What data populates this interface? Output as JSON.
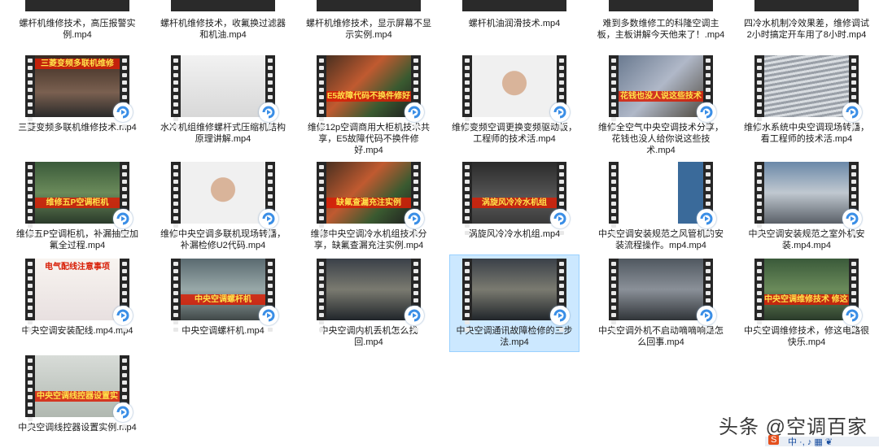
{
  "top_row": [
    {
      "label": "螺杆机维修技术，高压报警实例.mp4"
    },
    {
      "label": "螺杆机维修技术，收氟换过滤器和机油.mp4"
    },
    {
      "label": "螺杆机维修技术，显示屏幕不显示实例.mp4"
    },
    {
      "label": "螺杆机油润滑技术.mp4"
    },
    {
      "label": "难到多数维修工的科隆空调主板，主板讲解今天他来了！.mp4"
    },
    {
      "label": "四冷水机制冷效果差，维修调试2小时搞定开车用了8小时.mp4"
    }
  ],
  "files": [
    {
      "label": "三菱变频多联机维修技术.mp4",
      "banner": "三菱变频多联机维修",
      "theme": "panel"
    },
    {
      "label": "水冷机组维修螺杆式压缩机结构原理讲解.mp4",
      "banner": "",
      "theme": "white"
    },
    {
      "label": "维修12p空调商用大柜机技术共享，E5故障代码不换件修好.mp4",
      "banner": "E5故障代码不换件修好",
      "theme": "board"
    },
    {
      "label": "维修变频空调更换变频驱动板，工程师的技术活.mp4",
      "banner": "",
      "theme": "face"
    },
    {
      "label": "维修全空气中央空调技术分享，花钱也没人给你说这些技术.mp4",
      "banner": "花钱也没人说这些技术",
      "theme": "wires"
    },
    {
      "label": "维修水系统中央空调现场转播，看工程师的技术活.mp4",
      "banner": "",
      "theme": "grille"
    },
    {
      "label": "维修五P空调柜机，补漏抽空加氟全过程.mp4",
      "banner": "维修五P空调柜机",
      "theme": "green"
    },
    {
      "label": "维修中央空调多联机现场转播，补漏检修U2代码.mp4",
      "banner": "",
      "theme": "face"
    },
    {
      "label": "维修中央空调冷水机组技术分享，缺氟查漏充注实例.mp4",
      "banner": "缺氟查漏充注实例",
      "theme": "board"
    },
    {
      "label": "涡旋风冷冷水机组.mp4",
      "banner": "涡旋风冷冷水机组",
      "theme": "dark"
    },
    {
      "label": "中央空调安装规范之风管机的安装流程操作。mp4.mp4",
      "banner": "",
      "theme": "slides"
    },
    {
      "label": "中央空调安装规范之室外机安装.mp4.mp4",
      "banner": "",
      "theme": "outdoor"
    },
    {
      "label": "中央空调安装配线.mp4.mp4",
      "banner": "电气配线注意事项",
      "theme": "doc"
    },
    {
      "label": "中央空调螺杆机.mp4",
      "banner": "中央空调螺杆机",
      "theme": "machine"
    },
    {
      "label": "中央空调内机丢机怎么找回.mp4",
      "banner": "",
      "theme": "people"
    },
    {
      "label": "中央空调通讯故障检修的三步法.mp4",
      "banner": "",
      "theme": "people"
    },
    {
      "label": "中央空调外机不启动嘀嘀响是怎么回事.mp4",
      "banner": "",
      "theme": "crowd"
    },
    {
      "label": "中央空调维修技术，修这电路很快乐.mp4",
      "banner": "中央空调维修技术 修这电路很快乐",
      "theme": "green"
    },
    {
      "label": "中央空调线控器设置实例.mp4",
      "banner": "中央空调线控器设置实",
      "theme": "lcd"
    }
  ],
  "selected_index": 15,
  "video_badge_icon": "media-player-icon",
  "watermark": "头条 @空调百家",
  "tray": {
    "text": "中 ·, ♪ ▦ ❦",
    "logo": "S"
  },
  "colors": {
    "selection": "#cce8ff",
    "badge_blue": "#3a8ee6",
    "banner_red": "#d81e06"
  }
}
